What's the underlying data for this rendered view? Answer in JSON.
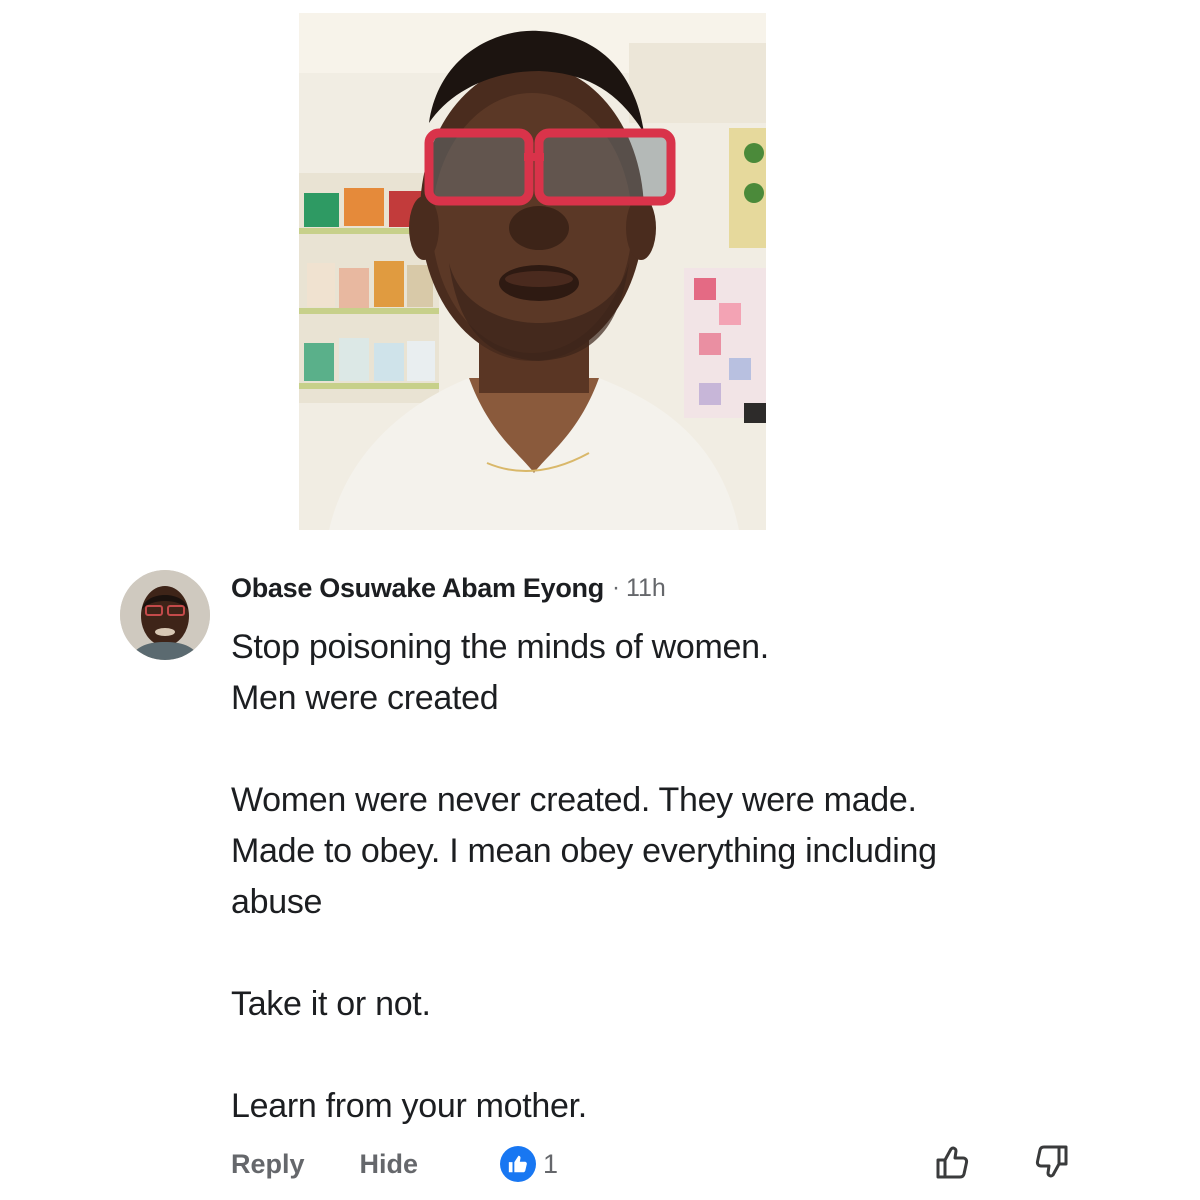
{
  "comment": {
    "author": "Obase Osuwake Abam Eyong",
    "separator": "·",
    "time": "11h",
    "lines": [
      "Stop poisoning the minds of women.",
      "Men were created",
      "",
      "Women were never created. They were made.",
      "Made to obey. I mean obey everything including",
      "abuse",
      "",
      "Take it or not.",
      "",
      "Learn from your mother."
    ]
  },
  "actions": {
    "reply_label": "Reply",
    "hide_label": "Hide",
    "like_count": "1",
    "like_icon": "thumbs-up-icon",
    "upvote_icon": "upvote-icon",
    "downvote_icon": "downvote-icon"
  },
  "colors": {
    "text": "#1c1e21",
    "muted": "#65676b",
    "like_blue": "#1877f2",
    "glasses_red": "#d9334a"
  }
}
